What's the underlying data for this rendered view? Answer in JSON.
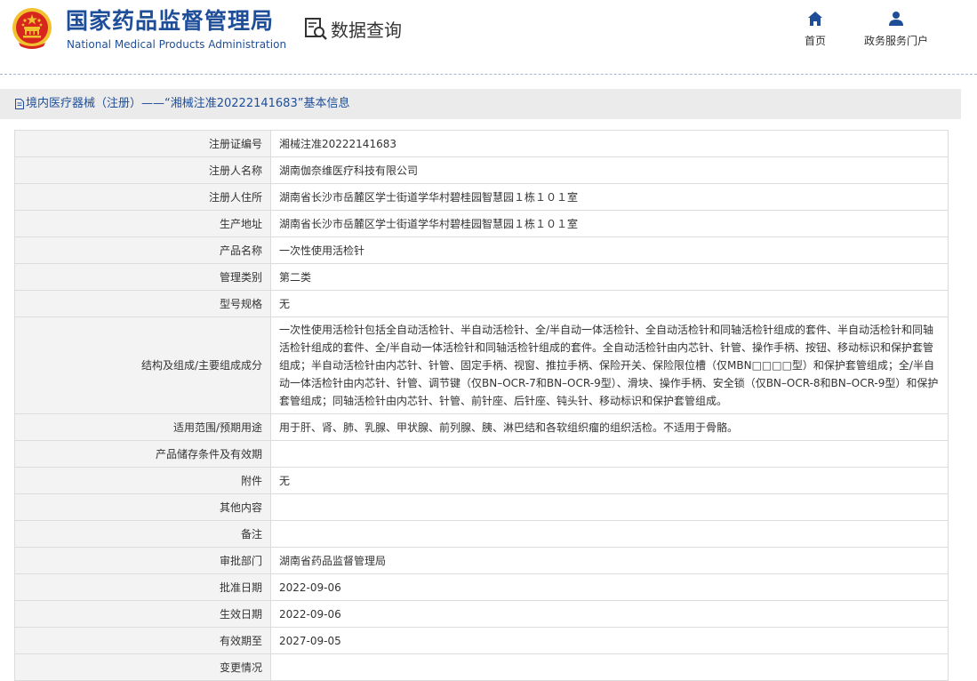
{
  "header": {
    "agency_name_cn": "国家药品监督管理局",
    "agency_name_en": "National Medical Products Administration",
    "query_label": "数据查询",
    "nav": [
      {
        "label": "首页",
        "icon": "home-icon"
      },
      {
        "label": "政务服务门户",
        "icon": "user-icon"
      }
    ]
  },
  "info_bar": {
    "title": "境内医疗器械（注册）——“湘械注准20222141683”基本信息"
  },
  "colors": {
    "brand_blue": "#1f4e99",
    "emblem_red": "#d7261d",
    "emblem_gold": "#f2c12e"
  },
  "rows": [
    {
      "label": "注册证编号",
      "value": "湘械注准20222141683"
    },
    {
      "label": "注册人名称",
      "value": "湖南伽奈维医疗科技有限公司"
    },
    {
      "label": "注册人住所",
      "value": "湖南省长沙市岳麓区学士街道学华村碧桂园智慧园１栋１０１室"
    },
    {
      "label": "生产地址",
      "value": "湖南省长沙市岳麓区学士街道学华村碧桂园智慧园１栋１０１室"
    },
    {
      "label": "产品名称",
      "value": "一次性使用活检针"
    },
    {
      "label": "管理类别",
      "value": "第二类"
    },
    {
      "label": "型号规格",
      "value": "无"
    },
    {
      "label": "结构及组成/主要组成成分",
      "value": "一次性使用活检针包括全自动活检针、半自动活检针、全/半自动一体活检针、全自动活检针和同轴活检针组成的套件、半自动活检针和同轴活检针组成的套件、全/半自动一体活检针和同轴活检针组成的套件。全自动活检针由内芯针、针管、操作手柄、按钮、移动标识和保护套管组成；半自动活检针由内芯针、针管、固定手柄、视窗、推拉手柄、保险开关、保险限位槽（仅MBN□□□□型）和保护套管组成；全/半自动一体活检针由内芯针、针管、调节键（仅BN–OCR-7和BN–OCR-9型）、滑块、操作手柄、安全锁（仅BN–OCR-8和BN–OCR-9型）和保护套管组成；同轴活检针由内芯针、针管、前针座、后针座、钝头针、移动标识和保护套管组成。"
    },
    {
      "label": "适用范围/预期用途",
      "value": "用于肝、肾、肺、乳腺、甲状腺、前列腺、胰、淋巴结和各软组织瘤的组织活检。不适用于骨骼。"
    },
    {
      "label": "产品储存条件及有效期",
      "value": ""
    },
    {
      "label": "附件",
      "value": "无"
    },
    {
      "label": "其他内容",
      "value": ""
    },
    {
      "label": "备注",
      "value": ""
    },
    {
      "label": "审批部门",
      "value": "湖南省药品监督管理局"
    },
    {
      "label": "批准日期",
      "value": "2022-09-06"
    },
    {
      "label": "生效日期",
      "value": "2022-09-06"
    },
    {
      "label": "有效期至",
      "value": "2027-09-05"
    },
    {
      "label": "变更情况",
      "value": ""
    }
  ]
}
